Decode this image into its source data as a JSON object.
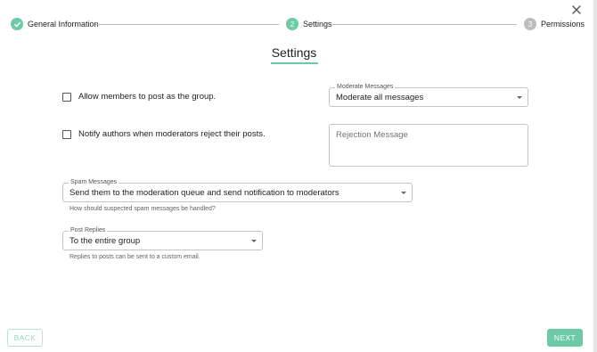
{
  "stepper": {
    "steps": [
      {
        "label": "General Information",
        "number": "",
        "state": "completed",
        "color": "#6dcaa7"
      },
      {
        "label": "Settings",
        "number": "2",
        "state": "active",
        "color": "#6dcaa7"
      },
      {
        "label": "Permissions",
        "number": "3",
        "state": "inactive",
        "color": "#bdbdbd"
      }
    ]
  },
  "page": {
    "title": "Settings"
  },
  "options": {
    "allow_post_as_group": {
      "label": "Allow members to post as the group.",
      "checked": false
    },
    "notify_authors": {
      "label": "Notify authors when moderators reject their posts.",
      "checked": false
    }
  },
  "moderate_messages": {
    "label": "Moderate Messages",
    "value": "Moderate all messages"
  },
  "rejection_message": {
    "placeholder": "Rejection Message"
  },
  "spam_messages": {
    "label": "Spam Messages",
    "value": "Send them to the moderation queue and send notification to moderators",
    "helper": "How should suspected spam messages be handled?"
  },
  "post_replies": {
    "label": "Post Replies",
    "value": "To the entire group",
    "helper": "Replies to posts can be sent to a custom email."
  },
  "footer": {
    "back_label": "BACK",
    "next_label": "NEXT"
  },
  "colors": {
    "accent": "#6dcaa7",
    "inactive": "#bdbdbd"
  }
}
